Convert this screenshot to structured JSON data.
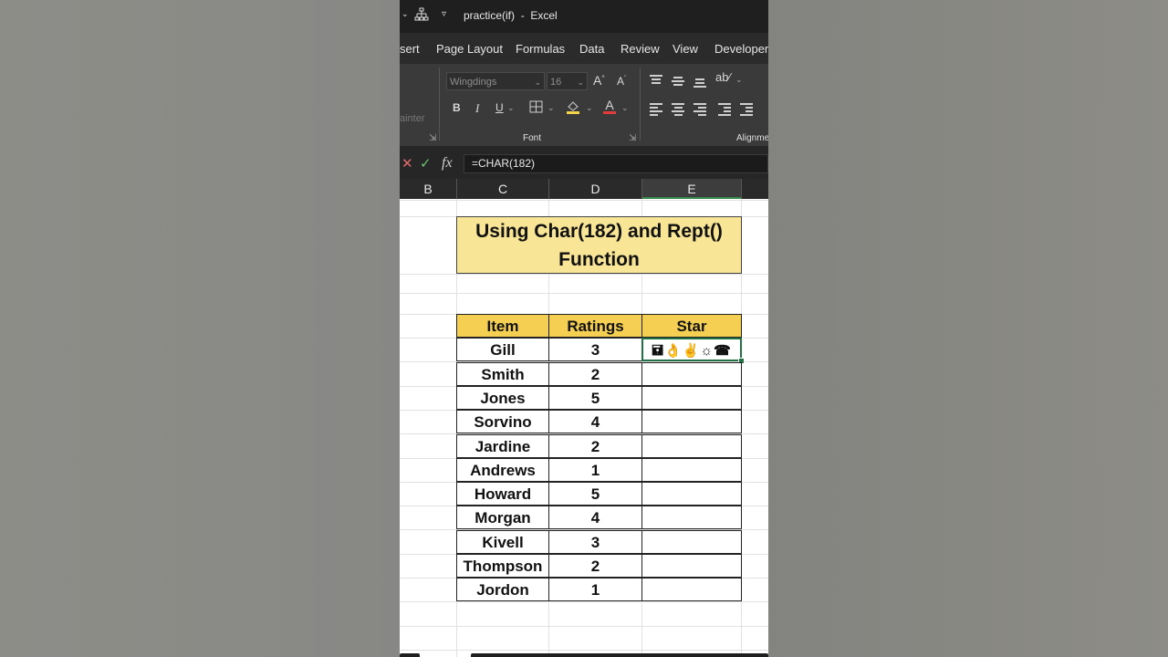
{
  "window": {
    "title": "practice(if)",
    "app": "Excel",
    "separator": "-"
  },
  "ribbon_tabs": [
    "sert",
    "Page Layout",
    "Formulas",
    "Data",
    "Review",
    "View",
    "Developer"
  ],
  "ribbon": {
    "font_name": "Wingdings",
    "font_size": "16",
    "font_group_label": "Font",
    "alignment_group_label": "Alignme",
    "painter_label": "ainter",
    "bold": "B",
    "italic": "I",
    "underline": "U",
    "grow_font": "A",
    "shrink_font": "A",
    "font_color": "A"
  },
  "formula_bar": {
    "cancel": "✕",
    "enter": "✓",
    "fx": "fx",
    "formula": "=CHAR(182)"
  },
  "columns": [
    "B",
    "C",
    "D",
    "E"
  ],
  "selected_column": "E",
  "sheet": {
    "title_line1": "Using Char(182) and Rept()",
    "title_line2": "Function",
    "headers": [
      "Item",
      "Ratings",
      "Star"
    ],
    "rows": [
      {
        "item": "Gill",
        "rating": "3",
        "star": "🖬👌✌☼☎"
      },
      {
        "item": "Smith",
        "rating": "2",
        "star": ""
      },
      {
        "item": "Jones",
        "rating": "5",
        "star": ""
      },
      {
        "item": "Sorvino",
        "rating": "4",
        "star": ""
      },
      {
        "item": "Jardine",
        "rating": "2",
        "star": ""
      },
      {
        "item": "Andrews",
        "rating": "1",
        "star": ""
      },
      {
        "item": "Howard",
        "rating": "5",
        "star": ""
      },
      {
        "item": "Morgan",
        "rating": "4",
        "star": ""
      },
      {
        "item": "Kivell",
        "rating": "3",
        "star": ""
      },
      {
        "item": "Thompson",
        "rating": "2",
        "star": ""
      },
      {
        "item": "Jordon",
        "rating": "1",
        "star": ""
      }
    ],
    "active_cell": "E"
  },
  "colors": {
    "title_fill": "#f8e596",
    "header_fill": "#f5cf52",
    "selection_green": "#217346",
    "cancel_red": "#e06c6c",
    "enter_green": "#6cc26c"
  }
}
